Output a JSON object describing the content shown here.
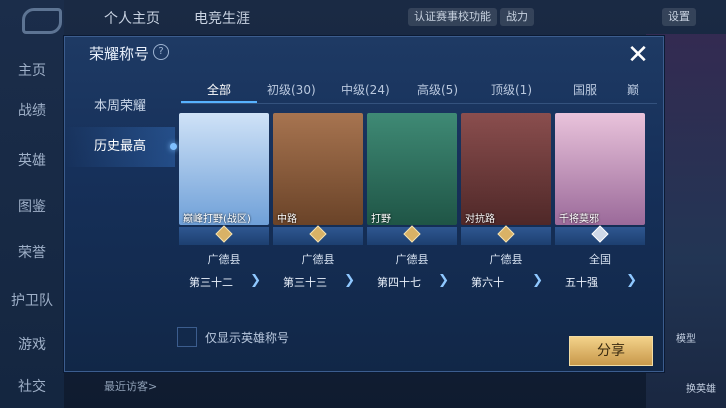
{
  "side_nav": [
    "主页",
    "战绩",
    "英雄",
    "图鉴",
    "荣誉",
    "护卫队",
    "游戏",
    "社交"
  ],
  "topbar": {
    "tabs": [
      "个人主页",
      "电竞生涯"
    ],
    "chips": [
      "认证赛事校功能",
      "战力",
      "设置"
    ]
  },
  "bottom_bar": {
    "hint": "最近访客>"
  },
  "right_deco": {
    "label1": "模型",
    "label2": "换英雄"
  },
  "dialog": {
    "title": "荣耀称号",
    "help_icon": "?",
    "close_icon": "✕",
    "left_menu": [
      "本周荣耀",
      "历史最高"
    ],
    "tabs": [
      "全部",
      "初级(30)",
      "中级(24)",
      "高级(5)",
      "顶级(1)",
      "国服",
      "巅"
    ],
    "cards": [
      {
        "name": "巅峰打野(战区)",
        "region": "广德县",
        "rank": "第三十二",
        "art": "#6fa0d8"
      },
      {
        "name": "中路",
        "region": "广德县",
        "rank": "第三十三",
        "art": "#8a5a3c"
      },
      {
        "name": "打野",
        "region": "广德县",
        "rank": "第四十七",
        "art": "#2f6b5a"
      },
      {
        "name": "对抗路",
        "region": "广德县",
        "rank": "第六十",
        "art": "#6a3b3b"
      },
      {
        "name": "千将莫邪",
        "region": "全国",
        "rank": "五十强",
        "art": "#c48fb0"
      }
    ],
    "checkbox_label": "仅显示英雄称号",
    "share_button": "分享"
  },
  "colors": {
    "accent": "#57b2ff",
    "gold": "#d9b266"
  }
}
